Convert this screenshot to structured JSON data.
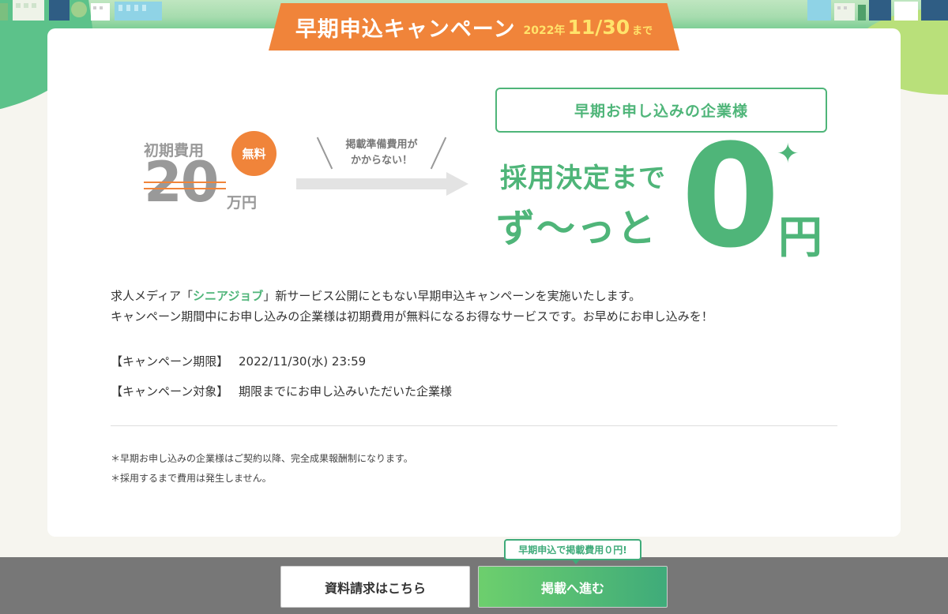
{
  "campaign": {
    "title": "早期申込キャンペーン",
    "year": "2022年",
    "month_day": "11/30",
    "until": "まで"
  },
  "initial_cost": {
    "label": "初期費用",
    "amount": "20",
    "unit": "万円",
    "badge": "無料"
  },
  "arrow_note": {
    "line1": "掲載準備費用が",
    "line2": "かからない！"
  },
  "promo": {
    "target_label": "早期お申し込みの企業様",
    "line1": "採用決定まで",
    "line2": "ず〜っと",
    "zero": "0",
    "yen": "円",
    "sparkle": "✦"
  },
  "description": {
    "prefix": "求人メディア「",
    "brand": "シニアジョブ",
    "suffix": "」新サービス公開にともない早期申込キャンペーンを実施いたします。",
    "line2": "キャンペーン期間中にお申し込みの企業様は初期費用が無料になるお得なサービスです。お早めにお申し込みを！"
  },
  "details": {
    "period_label": "【キャンペーン期限】",
    "period_value": "2022/11/30(水) 23:59",
    "target_label": "【キャンペーン対象】",
    "target_value": "期限までにお申し込みいただいた企業様"
  },
  "notes": [
    "＊早期お申し込みの企業様はご契約以降、完全成果報酬制になります。",
    "＊採用するまで費用は発生しません。"
  ],
  "footer": {
    "doc_button": "資料請求はこちら",
    "post_button": "掲載へ進む",
    "bubble": "早期申込で掲載費用０円!"
  },
  "colors": {
    "accent_orange": "#f0843a",
    "accent_green": "#4fb579",
    "date_yellow": "#ffe36b"
  }
}
